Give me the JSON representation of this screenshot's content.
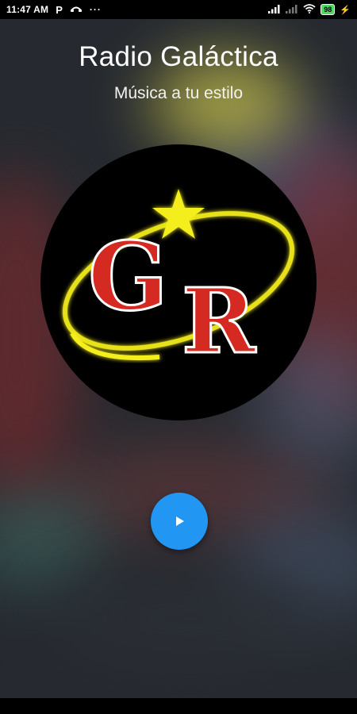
{
  "status_bar": {
    "time": "11:47 AM",
    "app_indicator": "P",
    "more": "···",
    "battery_level": "98",
    "icons": [
      "p-icon",
      "call-icon",
      "more-icon",
      "signal-icon",
      "wifi-icon",
      "battery-icon",
      "charging-icon"
    ]
  },
  "app": {
    "title": "Radio Galáctica",
    "subtitle": "Música a tu estilo"
  },
  "logo": {
    "letters": "GR",
    "colors": {
      "letters": "#d42a22",
      "ring": "#f4ee1c",
      "star": "#f4ee1c",
      "background": "#000000"
    }
  },
  "player": {
    "button_icon": "play-icon",
    "button_color": "#2196f3"
  }
}
